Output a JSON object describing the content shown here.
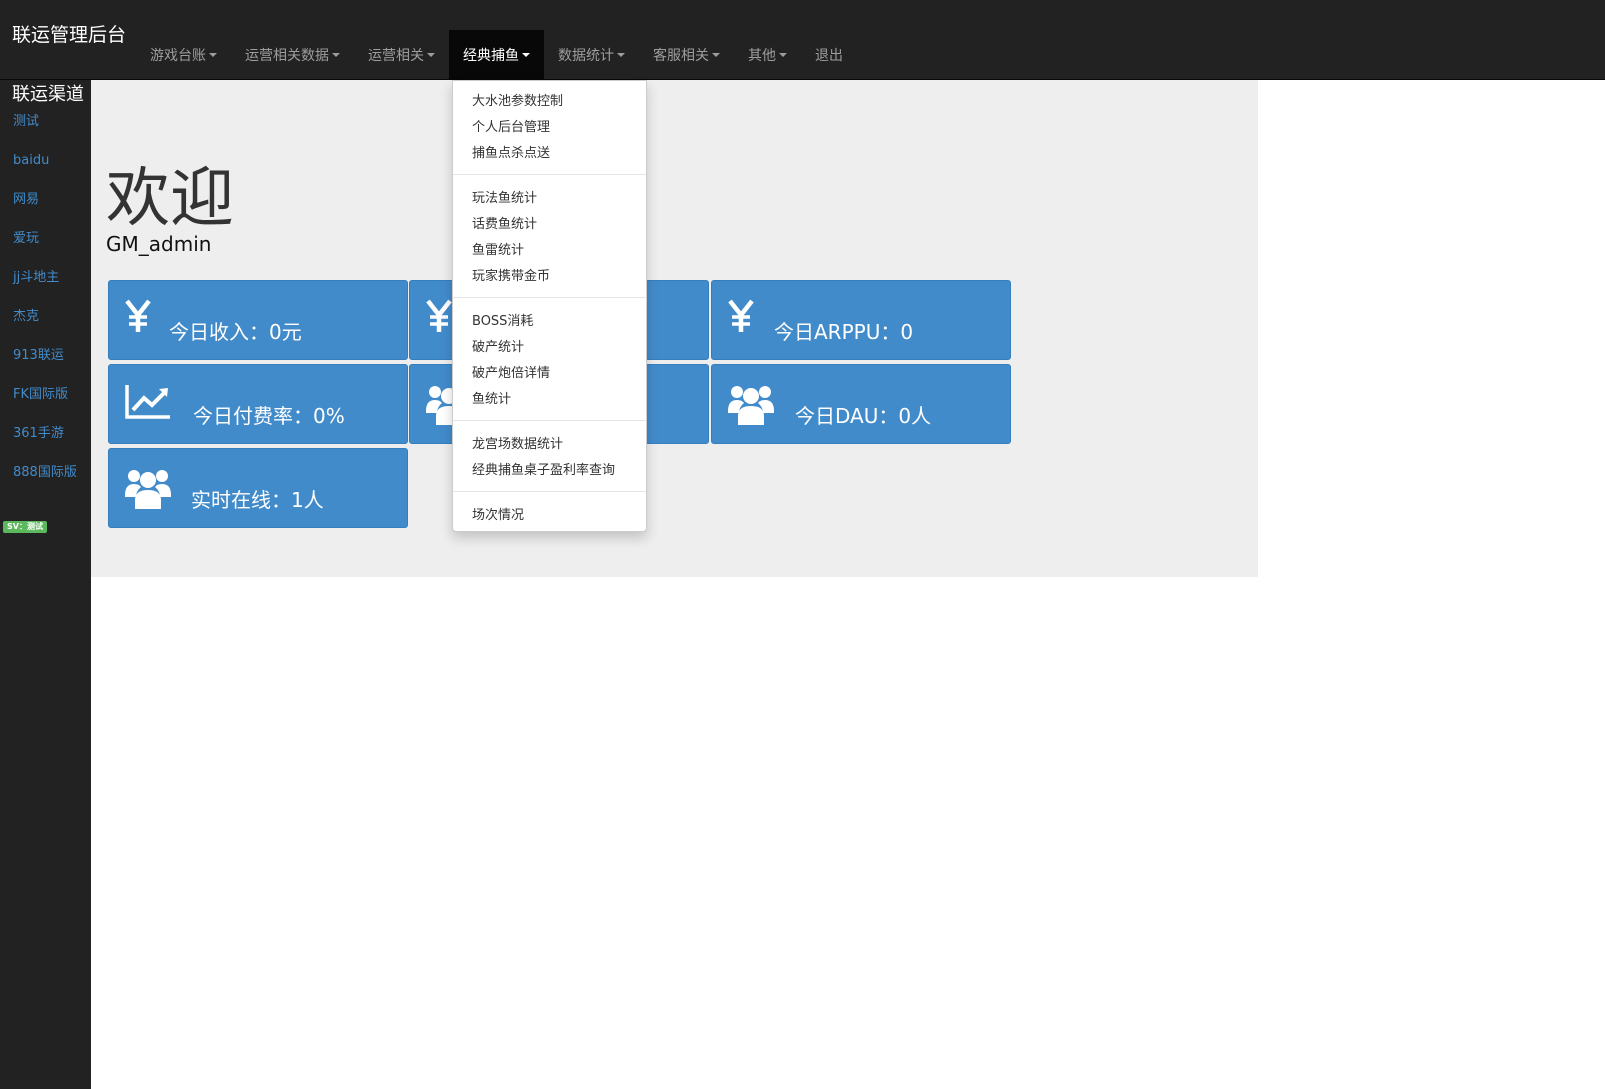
{
  "navbar": {
    "brand": "联运管理后台",
    "items": [
      {
        "label": "游戏台账",
        "dropdown": true
      },
      {
        "label": "运营相关数据",
        "dropdown": true
      },
      {
        "label": "运营相关",
        "dropdown": true
      },
      {
        "label": "经典捕鱼",
        "dropdown": true,
        "active": true
      },
      {
        "label": "数据统计",
        "dropdown": true
      },
      {
        "label": "客服相关",
        "dropdown": true
      },
      {
        "label": "其他",
        "dropdown": true
      },
      {
        "label": "退出",
        "dropdown": false
      }
    ]
  },
  "sidebar": {
    "title": "联运渠道",
    "items": [
      "测试",
      "baidu",
      "网易",
      "爱玩",
      "jj斗地主",
      "杰克",
      "913联运",
      "FK国际版",
      "361手游",
      "888国际版"
    ],
    "badge": "SV：测试"
  },
  "main": {
    "welcome": "欢迎",
    "user": "GM_admin"
  },
  "cards": [
    {
      "icon": "yen-icon",
      "label": "今日收入：0元"
    },
    {
      "icon": "yen-icon",
      "label": ""
    },
    {
      "icon": "yen-icon",
      "label": "今日ARPPU：0"
    },
    {
      "icon": "line-chart-icon",
      "label": "今日付费率：0%"
    },
    {
      "icon": "users-icon",
      "label": ""
    },
    {
      "icon": "users-icon",
      "label": "今日DAU：0人"
    },
    {
      "icon": "users-icon",
      "label": "实时在线：1人"
    }
  ],
  "dropdown": {
    "groups": [
      [
        "大水池参数控制",
        "个人后台管理",
        "捕鱼点杀点送"
      ],
      [
        "玩法鱼统计",
        "话费鱼统计",
        "鱼雷统计",
        "玩家携带金币"
      ],
      [
        "BOSS消耗",
        "破产统计",
        "破产炮倍详情",
        "鱼统计"
      ],
      [
        "龙宫场数据统计",
        "经典捕鱼桌子盈利率查询"
      ],
      [
        "场次情况"
      ]
    ]
  },
  "colors": {
    "navbar_bg": "#222222",
    "card_bg": "#428bca",
    "link": "#428bca",
    "jumbotron_bg": "#eeeeee",
    "badge": "#5cb85c"
  }
}
